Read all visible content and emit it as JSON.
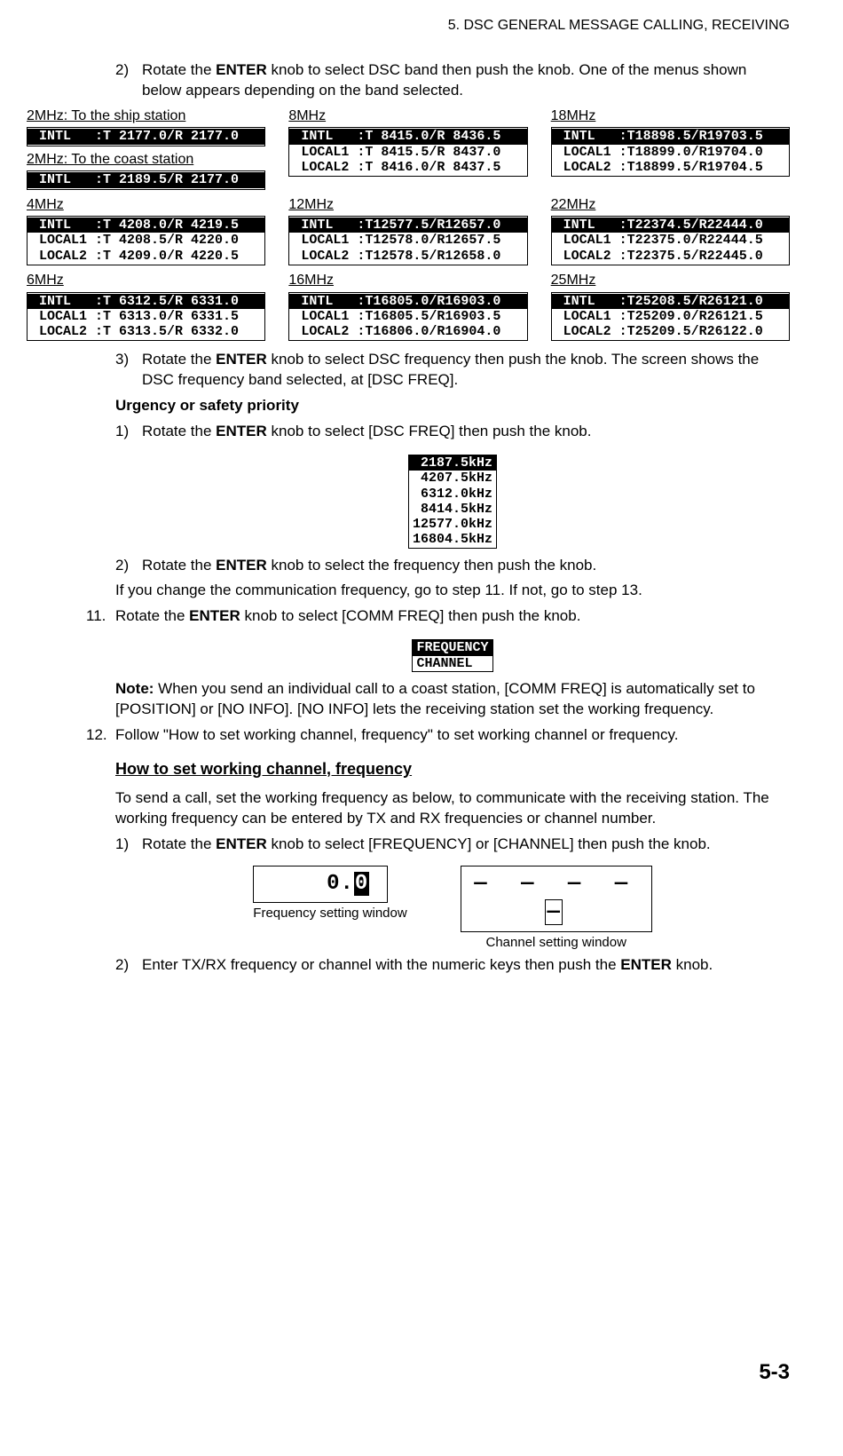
{
  "header": "5.  DSC GENERAL MESSAGE CALLING, RECEIVING",
  "step2_num": "2)",
  "step2_text_a": "Rotate the ",
  "step2_bold": "ENTER",
  "step2_text_b": " knob to select DSC band then push the knob. One of the menus shown below appears depending on the band selected.",
  "bands": {
    "c0r0": {
      "ship": {
        "label": "2MHz: To the ship station",
        "rows": [
          " INTL   :T 2177.0/R 2177.0"
        ],
        "inv": [
          true
        ]
      },
      "coast": {
        "label": "2MHz: To the coast station",
        "rows": [
          " INTL   :T 2189.5/R 2177.0"
        ],
        "inv": [
          true
        ]
      }
    },
    "c1r0": {
      "label": "8MHz",
      "rows": [
        " INTL   :T 8415.0/R 8436.5",
        " LOCAL1 :T 8415.5/R 8437.0",
        " LOCAL2 :T 8416.0/R 8437.5"
      ],
      "inv": [
        true,
        false,
        false
      ]
    },
    "c2r0": {
      "label": "18MHz",
      "rows": [
        " INTL   :T18898.5/R19703.5",
        " LOCAL1 :T18899.0/R19704.0",
        " LOCAL2 :T18899.5/R19704.5"
      ],
      "inv": [
        true,
        false,
        false
      ]
    },
    "c0r1": {
      "label": "4MHz",
      "rows": [
        " INTL   :T 4208.0/R 4219.5",
        " LOCAL1 :T 4208.5/R 4220.0",
        " LOCAL2 :T 4209.0/R 4220.5"
      ],
      "inv": [
        true,
        false,
        false
      ]
    },
    "c1r1": {
      "label": "12MHz",
      "rows": [
        " INTL   :T12577.5/R12657.0",
        " LOCAL1 :T12578.0/R12657.5",
        " LOCAL2 :T12578.5/R12658.0"
      ],
      "inv": [
        true,
        false,
        false
      ]
    },
    "c2r1": {
      "label": "22MHz",
      "rows": [
        " INTL   :T22374.5/R22444.0",
        " LOCAL1 :T22375.0/R22444.5",
        " LOCAL2 :T22375.5/R22445.0"
      ],
      "inv": [
        true,
        false,
        false
      ]
    },
    "c0r2": {
      "label": "6MHz",
      "rows": [
        " INTL   :T 6312.5/R 6331.0",
        " LOCAL1 :T 6313.0/R 6331.5",
        " LOCAL2 :T 6313.5/R 6332.0"
      ],
      "inv": [
        true,
        false,
        false
      ]
    },
    "c1r2": {
      "label": "16MHz",
      "rows": [
        " INTL   :T16805.0/R16903.0",
        " LOCAL1 :T16805.5/R16903.5",
        " LOCAL2 :T16806.0/R16904.0"
      ],
      "inv": [
        true,
        false,
        false
      ]
    },
    "c2r2": {
      "label": "25MHz",
      "rows": [
        " INTL   :T25208.5/R26121.0",
        " LOCAL1 :T25209.0/R26121.5",
        " LOCAL2 :T25209.5/R26122.0"
      ],
      "inv": [
        true,
        false,
        false
      ]
    }
  },
  "step3_num": "3)",
  "step3_a": "Rotate the ",
  "step3_bold": "ENTER",
  "step3_b": " knob to select DSC frequency then push the knob. The screen shows the DSC frequency band selected, at [DSC FREQ].",
  "urgency_head": "Urgency or safety priority",
  "u1_num": "1)",
  "u1_a": "Rotate the ",
  "u1_bold": "ENTER",
  "u1_b": " knob to select [DSC FREQ] then push the knob.",
  "freq_list": [
    " 2187.5kHz",
    " 4207.5kHz",
    " 6312.0kHz",
    " 8414.5kHz",
    "12577.0kHz",
    "16804.5kHz"
  ],
  "freq_list_inv": [
    true,
    false,
    false,
    false,
    false,
    false
  ],
  "u2_num": "2)",
  "u2_a": "Rotate the ",
  "u2_bold": "ENTER",
  "u2_b": " knob to select the frequency then push the knob.",
  "u_if": "If you change the communication frequency, go to step 11. If not, go to step 13.",
  "s11_num": "11.",
  "s11_a": "Rotate the ",
  "s11_bold": "ENTER",
  "s11_b": " knob to select [COMM FREQ] then push the knob.",
  "mini_rows": [
    "FREQUENCY",
    "CHANNEL  "
  ],
  "mini_inv": [
    true,
    false
  ],
  "note_label": "Note:",
  "note_text": " When you send an individual call to a coast station, [COMM FREQ] is automatically set to [POSITION] or [NO INFO]. [NO INFO] lets the receiving station set the working frequency.",
  "s12_num": "12.",
  "s12_text": "Follow \"How to set working channel, frequency\" to set working channel or frequency.",
  "howto_head": "How to set working channel, frequency",
  "howto_intro": "To send a call, set the working frequency as below, to communicate with the receiving station. The working frequency can be entered by TX and RX frequencies or channel number.",
  "h1_num": "1)",
  "h1_a": "Rotate the ",
  "h1_bold": "ENTER",
  "h1_b": " knob to select [FREQUENCY] or [CHANNEL] then push the knob.",
  "fw_prefix": "0.",
  "fw_cursor": "0",
  "cw_segs": "———— ",
  "cw_last": "—",
  "fw_caption": "Frequency setting window",
  "cw_caption": "Channel setting window",
  "h2_num": "2)",
  "h2_a": "Enter TX/RX frequency or channel with the numeric keys then push the ",
  "h2_bold": "ENTER",
  "h2_b": " knob.",
  "page_num": "5-3"
}
